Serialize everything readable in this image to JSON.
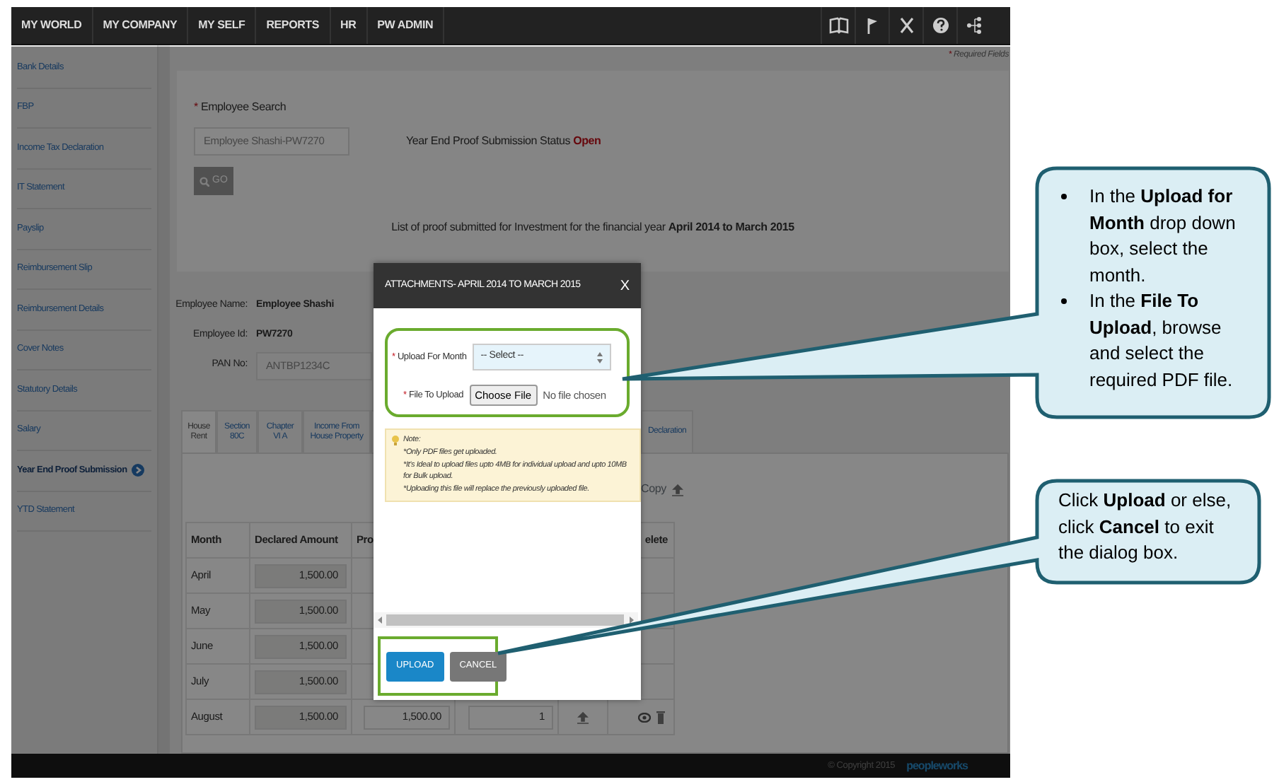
{
  "navbar": {
    "menu": [
      {
        "label": "MY WORLD"
      },
      {
        "label": "MY COMPANY"
      },
      {
        "label": "MY SELF"
      },
      {
        "label": "REPORTS"
      },
      {
        "label": "HR"
      },
      {
        "label": "PW ADMIN"
      }
    ]
  },
  "sidebar": {
    "items": [
      {
        "label": "Bank Details",
        "selected": false
      },
      {
        "label": "FBP",
        "selected": false
      },
      {
        "label": "Income Tax Declaration",
        "selected": false
      },
      {
        "label": "IT Statement",
        "selected": false
      },
      {
        "label": "Payslip",
        "selected": false
      },
      {
        "label": "Reimbursement Slip",
        "selected": false
      },
      {
        "label": "Reimbursement Details",
        "selected": false
      },
      {
        "label": "Cover Notes",
        "selected": false
      },
      {
        "label": "Statutory Details",
        "selected": false
      },
      {
        "label": "Salary",
        "selected": false
      },
      {
        "label": "Year End Proof Submission",
        "selected": true
      },
      {
        "label": "YTD Statement",
        "selected": false
      }
    ]
  },
  "required_note": {
    "mark": "*",
    "text": "Required Fields"
  },
  "search": {
    "mark": "*",
    "label": "Employee Search",
    "value": "Employee Shashi-PW7270",
    "status_label": "Year End Proof Submission Status",
    "status_value": "Open",
    "go_button": "GO",
    "summary": "List of proof submitted for Investment for the financial year **April 2014 to March 2015**"
  },
  "employee": {
    "fields": [
      {
        "label": "Employee Name:",
        "value": "Employee Shashi",
        "kind": "text"
      },
      {
        "label": "Employee Id:",
        "value": "PW7270",
        "kind": "text"
      },
      {
        "label": "PAN No:",
        "value": "ANTBP1234C",
        "kind": "input"
      }
    ]
  },
  "tabs": [
    {
      "label": "House Rent",
      "selected": true
    },
    {
      "label": "Section 80C",
      "selected": false
    },
    {
      "label": "Chapter VI A",
      "selected": false
    },
    {
      "label": "Income From House Property",
      "selected": false
    },
    {
      "label": "Declaration",
      "selected": false
    }
  ],
  "copy_link": "Copy",
  "table": {
    "columns": [
      "Month",
      "Declared Amount",
      "Pro",
      "elete"
    ],
    "rows": [
      {
        "month": "April",
        "declared_amount": "1,500.00",
        "actions": false
      },
      {
        "month": "May",
        "declared_amount": "1,500.00",
        "actions": false
      },
      {
        "month": "June",
        "declared_amount": "1,500.00",
        "actions": false
      },
      {
        "month": "July",
        "declared_amount": "1,500.00",
        "actions": false
      },
      {
        "month": "August",
        "declared_amount": "1,500.00",
        "proof_amount": "1,500.00",
        "count": "1",
        "actions": true
      }
    ]
  },
  "dialog": {
    "title": "ATTACHMENTS- APRIL 2014 TO MARCH 2015",
    "close": "X",
    "month_field": {
      "mark": "*",
      "label": "Upload For Month",
      "value": "-- Select --"
    },
    "file_field": {
      "mark": "*",
      "label": "File To Upload",
      "button": "Choose File",
      "status": "No file chosen"
    },
    "note": {
      "title": "Note:",
      "lines": [
        "*Only PDF files get uploaded.",
        "*It's Ideal to upload files upto 4MB for individual upload and upto 10MB for Bulk upload.",
        "*Uploading this file will replace the previously uploaded file."
      ]
    },
    "buttons": [
      {
        "label": "UPLOAD",
        "kind": "primary"
      },
      {
        "label": "CANCEL",
        "kind": "secondary"
      }
    ]
  },
  "footer": {
    "copyright": "© Copyright 2015",
    "logo": "peopleworks"
  },
  "callouts": [
    {
      "kind": "bullets",
      "items": [
        "In the **Upload for Month** drop down box, select the month.",
        "In the **File To Upload**, browse and select the required PDF file."
      ]
    },
    {
      "kind": "text",
      "text": "Click **Upload** or else, click **Cancel** to exit the dialog box."
    }
  ]
}
